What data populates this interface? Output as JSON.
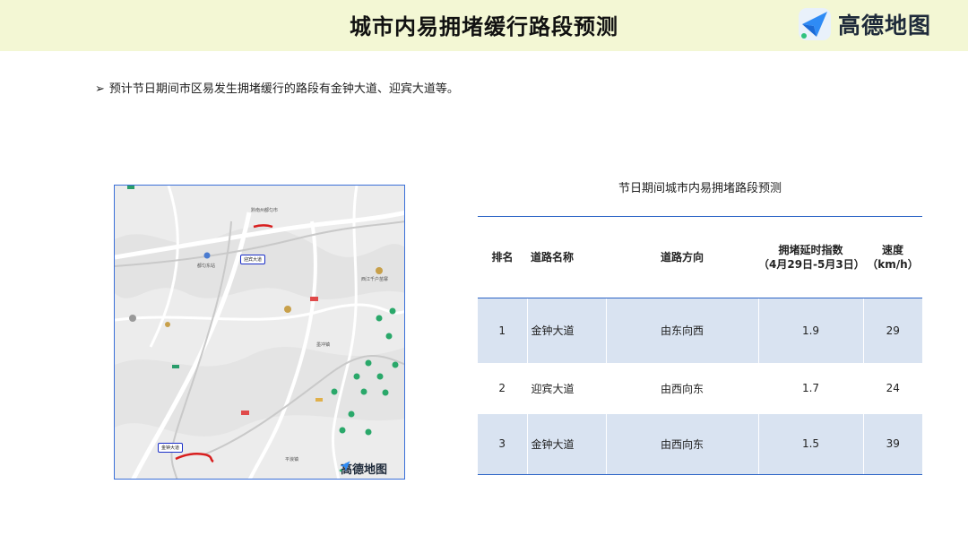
{
  "header": {
    "title": "城市内易拥堵缓行路段预测",
    "logo_text": "高德地图",
    "logo_icon": "amap-arrow-icon",
    "background": "#f3f7d4"
  },
  "summary": {
    "arrow": "➢",
    "text": "预计节日期间市区易发生拥堵缓行的路段有金钟大道、迎宾大道等。"
  },
  "map": {
    "labels": {
      "city": "黔南州都匀市",
      "road_tag_top": "迎宾大道",
      "road_tag_bottom": "金钟大道",
      "station": "都匀东站",
      "town": "墨冲镇",
      "scenic": "西江千户苗寨",
      "village": "平浪镇"
    },
    "logo_text": "高德地图",
    "congestion_color": "#d81e1e"
  },
  "table": {
    "title": "节日期间城市内易拥堵路段预测",
    "headers": {
      "rank": "排名",
      "road": "道路名称",
      "direction": "道路方向",
      "index_line1": "拥堵延时指数",
      "index_line2": "（4月29日-5月3日）",
      "speed_line1": "速度",
      "speed_line2": "（km/h）"
    },
    "rows": [
      {
        "rank": "1",
        "road": "金钟大道",
        "direction": "由东向西",
        "index": "1.9",
        "speed": "29"
      },
      {
        "rank": "2",
        "road": "迎宾大道",
        "direction": "由西向东",
        "index": "1.7",
        "speed": "24"
      },
      {
        "rank": "3",
        "road": "金钟大道",
        "direction": "由西向东",
        "index": "1.5",
        "speed": "39"
      }
    ],
    "accent": "#2b63c6",
    "row_shade": "#d9e3f1"
  }
}
